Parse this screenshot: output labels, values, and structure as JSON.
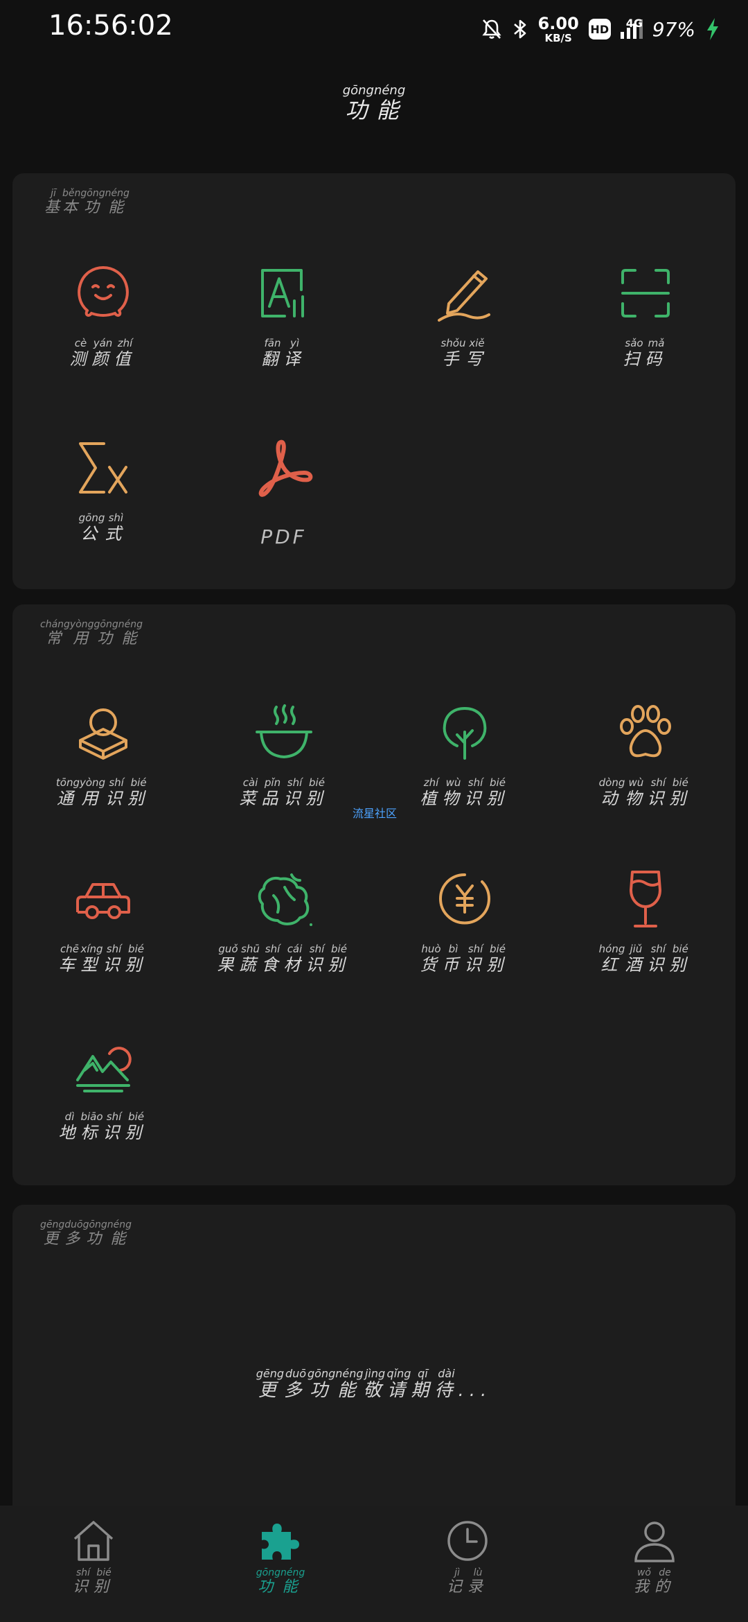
{
  "status_bar": {
    "time": "16:56:02",
    "net_speed_value": "6.00",
    "net_speed_unit": "KB/S",
    "hd_badge": "HD",
    "network_type": "4G",
    "battery": "97%"
  },
  "page_title": {
    "text": [
      "功",
      "能"
    ],
    "pinyin": [
      "gōng",
      "néng"
    ]
  },
  "sections": {
    "basic": {
      "title": {
        "text": [
          "基",
          "本",
          "功",
          "能"
        ],
        "pinyin": [
          "jī",
          "běn",
          "gōng",
          "néng"
        ]
      },
      "items": [
        {
          "icon": "face-icon",
          "color": "#e0604a",
          "text": [
            "测",
            "颜",
            "值"
          ],
          "pinyin": [
            "cè",
            "yán",
            "zhí"
          ]
        },
        {
          "icon": "translate-icon",
          "color": "#3fb36a",
          "text": [
            "翻",
            "译"
          ],
          "pinyin": [
            "fān",
            "yì"
          ]
        },
        {
          "icon": "pen-icon",
          "color": "#e3a55c",
          "text": [
            "手",
            "写"
          ],
          "pinyin": [
            "shǒu",
            "xiě"
          ]
        },
        {
          "icon": "scan-icon",
          "color": "#3fb36a",
          "text": [
            "扫",
            "码"
          ],
          "pinyin": [
            "sǎo",
            "mǎ"
          ]
        },
        {
          "icon": "formula-icon",
          "color": "#e3a55c",
          "text": [
            "公",
            "式"
          ],
          "pinyin": [
            "gōng",
            "shì"
          ]
        },
        {
          "icon": "pdf-icon",
          "color": "#e0604a",
          "plain_label": "PDF"
        }
      ]
    },
    "common": {
      "title": {
        "text": [
          "常",
          "用",
          "功",
          "能"
        ],
        "pinyin": [
          "cháng",
          "yòng",
          "gōng",
          "néng"
        ]
      },
      "items": [
        {
          "icon": "general-recognition-icon",
          "color": "#e3a55c",
          "text": [
            "通",
            "用",
            "识",
            "别"
          ],
          "pinyin": [
            "tōng",
            "yòng",
            "shí",
            "bié"
          ]
        },
        {
          "icon": "dish-icon",
          "color": "#3fb36a",
          "text": [
            "菜",
            "品",
            "识",
            "别"
          ],
          "pinyin": [
            "cài",
            "pǐn",
            "shí",
            "bié"
          ]
        },
        {
          "icon": "plant-icon",
          "color": "#3fb36a",
          "text": [
            "植",
            "物",
            "识",
            "别"
          ],
          "pinyin": [
            "zhí",
            "wù",
            "shí",
            "bié"
          ]
        },
        {
          "icon": "paw-icon",
          "color": "#e3a55c",
          "text": [
            "动",
            "物",
            "识",
            "别"
          ],
          "pinyin": [
            "dòng",
            "wù",
            "shí",
            "bié"
          ]
        },
        {
          "icon": "car-icon",
          "color": "#e0604a",
          "text": [
            "车",
            "型",
            "识",
            "别"
          ],
          "pinyin": [
            "chē",
            "xíng",
            "shí",
            "bié"
          ]
        },
        {
          "icon": "vegetable-icon",
          "color": "#3fb36a",
          "text": [
            "果",
            "蔬",
            "食",
            "材",
            "识",
            "别"
          ],
          "pinyin": [
            "guǒ",
            "shū",
            "shí",
            "cái",
            "shí",
            "bié"
          ]
        },
        {
          "icon": "currency-icon",
          "color": "#e3a55c",
          "text": [
            "货",
            "币",
            "识",
            "别"
          ],
          "pinyin": [
            "huò",
            "bì",
            "shí",
            "bié"
          ]
        },
        {
          "icon": "wine-icon",
          "color": "#e0604a",
          "text": [
            "红",
            "酒",
            "识",
            "别"
          ],
          "pinyin": [
            "hóng",
            "jiǔ",
            "shí",
            "bié"
          ]
        },
        {
          "icon": "landmark-icon",
          "color": "#3fb36a",
          "text": [
            "地",
            "标",
            "识",
            "别"
          ],
          "pinyin": [
            "dì",
            "biāo",
            "shí",
            "bié"
          ]
        }
      ]
    },
    "more": {
      "title": {
        "text": [
          "更",
          "多",
          "功",
          "能"
        ],
        "pinyin": [
          "gēng",
          "duō",
          "gōng",
          "néng"
        ]
      },
      "coming_soon": {
        "text": [
          "更",
          "多",
          "功",
          "能",
          "敬",
          "请",
          "期",
          "待"
        ],
        "pinyin": [
          "gēng",
          "duō",
          "gōng",
          "néng",
          "jìng",
          "qǐng",
          "qī",
          "dài"
        ],
        "suffix": "..."
      }
    }
  },
  "watermark": "流星社区",
  "bottom_nav": [
    {
      "icon": "home-icon",
      "text": [
        "识",
        "别"
      ],
      "pinyin": [
        "shí",
        "bié"
      ],
      "active": false
    },
    {
      "icon": "puzzle-icon",
      "text": [
        "功",
        "能"
      ],
      "pinyin": [
        "gōng",
        "néng"
      ],
      "active": true
    },
    {
      "icon": "clock-icon",
      "text": [
        "记",
        "录"
      ],
      "pinyin": [
        "jì",
        "lù"
      ],
      "active": false
    },
    {
      "icon": "user-icon",
      "text": [
        "我",
        "的"
      ],
      "pinyin": [
        "wǒ",
        "de"
      ],
      "active": false
    }
  ],
  "colors": {
    "accent": "#1aa190",
    "red": "#e0604a",
    "green": "#3fb36a",
    "orange": "#e3a55c"
  }
}
